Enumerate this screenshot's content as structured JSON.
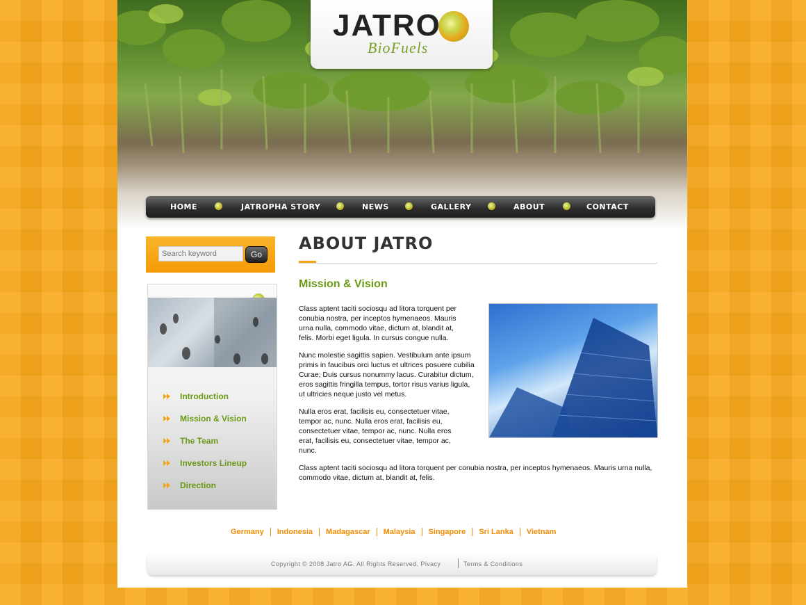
{
  "logo": {
    "name": "JATRO",
    "tagline": "BioFuels"
  },
  "nav": {
    "items": [
      {
        "label": "HOME"
      },
      {
        "label": "JATROPHA STORY"
      },
      {
        "label": "NEWS"
      },
      {
        "label": "GALLERY"
      },
      {
        "label": "ABOUT"
      },
      {
        "label": "CONTACT"
      }
    ]
  },
  "search": {
    "placeholder": "Search keyword",
    "button_label": "Go"
  },
  "sidebar": {
    "menu": [
      {
        "label": "Introduction"
      },
      {
        "label": "Mission & Vision"
      },
      {
        "label": "The Team"
      },
      {
        "label": "Investors Lineup"
      },
      {
        "label": "Direction"
      }
    ]
  },
  "main": {
    "title": "ABOUT JATRO",
    "section_heading": "Mission & Vision",
    "paragraphs": [
      "Class aptent taciti sociosqu ad litora torquent per conubia nostra, per inceptos hymenaeos. Mauris urna nulla, commodo vitae, dictum at, blandit at, felis. Morbi eget ligula. In cursus congue nulla.",
      "Nunc molestie sagittis sapien. Vestibulum ante ipsum primis in faucibus orci luctus et ultrices posuere cubilia Curae; Duis cursus nonummy lacus. Curabitur dictum, eros sagittis fringilla tempus, tortor risus varius ligula, ut ultricies neque justo vel metus.",
      "Nulla eros erat, facilisis eu, consectetuer vitae, tempor ac, nunc. Nulla eros erat, facilisis eu, consectetuer vitae, tempor ac, nunc. Nulla eros erat, facilisis eu, consectetuer vitae, tempor ac, nunc.",
      "Class aptent taciti sociosqu ad litora torquent per conubia nostra, per inceptos hymenaeos. Mauris urna nulla, commodo vitae, dictum at, blandit at, felis."
    ]
  },
  "countries": [
    "Germany",
    "Indonesia",
    "Madagascar",
    "Malaysia",
    "Singapore",
    "Sri Lanka",
    "Vietnam"
  ],
  "footer": {
    "copyright": "Copyright © 2008 Jatro AG. All Rights Reserved.  Pivacy",
    "terms": "Terms & Conditions"
  },
  "colors": {
    "accent": "#f5a314",
    "green": "#6a9a16",
    "background": "#f9a81c"
  }
}
